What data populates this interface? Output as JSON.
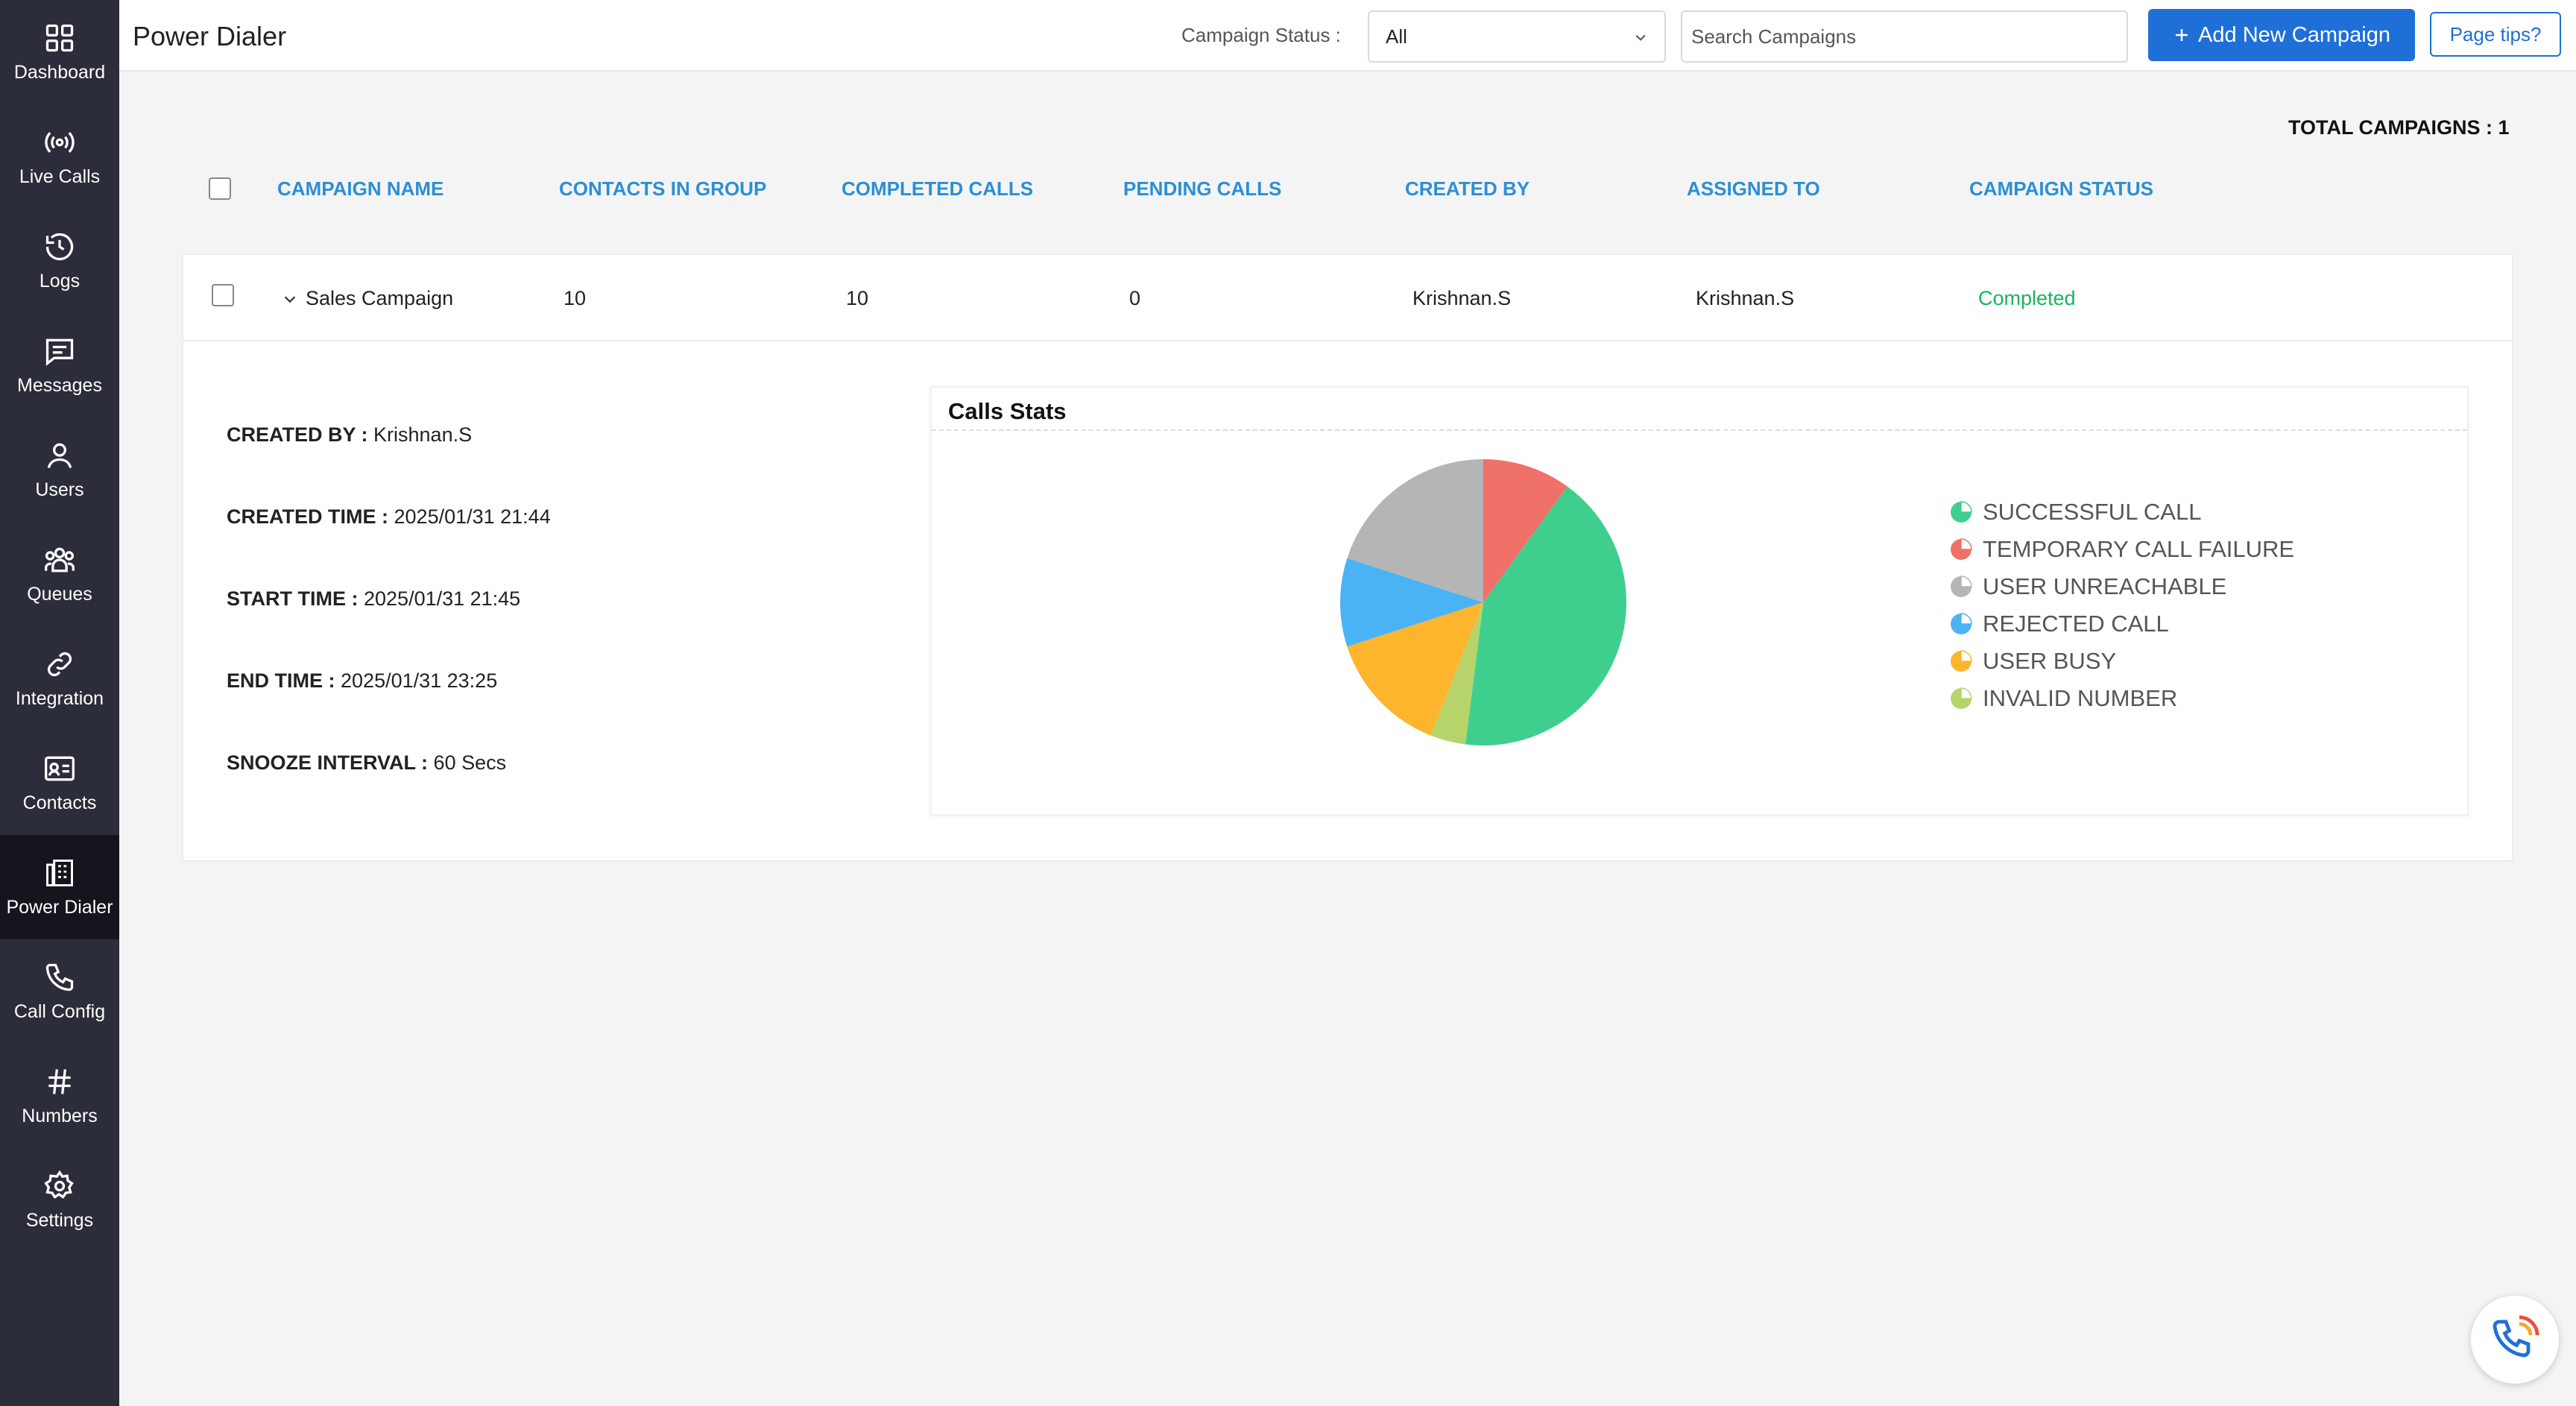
{
  "sidebar": {
    "items": [
      {
        "label": "Dashboard",
        "icon": "dashboard-icon"
      },
      {
        "label": "Live Calls",
        "icon": "broadcast-icon"
      },
      {
        "label": "Logs",
        "icon": "history-icon"
      },
      {
        "label": "Messages",
        "icon": "message-icon"
      },
      {
        "label": "Users",
        "icon": "user-icon"
      },
      {
        "label": "Queues",
        "icon": "group-icon"
      },
      {
        "label": "Integration",
        "icon": "link-icon"
      },
      {
        "label": "Contacts",
        "icon": "contact-card-icon"
      },
      {
        "label": "Power Dialer",
        "icon": "building-icon",
        "active": true
      },
      {
        "label": "Call Config",
        "icon": "phone-icon"
      },
      {
        "label": "Numbers",
        "icon": "hash-icon"
      },
      {
        "label": "Settings",
        "icon": "gear-icon"
      }
    ]
  },
  "header": {
    "title": "Power Dialer",
    "status_label": "Campaign Status :",
    "status_value": "All",
    "search_placeholder": "Search Campaigns",
    "add_button": "Add New Campaign",
    "tips_button": "Page tips?"
  },
  "total_campaigns": "TOTAL CAMPAIGNS : 1",
  "table": {
    "columns": [
      "CAMPAIGN NAME",
      "CONTACTS IN GROUP",
      "COMPLETED CALLS",
      "PENDING CALLS",
      "CREATED BY",
      "ASSIGNED TO",
      "CAMPAIGN STATUS"
    ],
    "rows": [
      {
        "name": "Sales Campaign",
        "contacts": "10",
        "completed": "10",
        "pending": "0",
        "created_by": "Krishnan.S",
        "assigned_to": "Krishnan.S",
        "status": "Completed"
      }
    ]
  },
  "details": {
    "created_by_label": "CREATED BY :",
    "created_by": "Krishnan.S",
    "created_time_label": "CREATED TIME :",
    "created_time": "2025/01/31 21:44",
    "start_time_label": "START TIME :",
    "start_time": "2025/01/31 21:45",
    "end_time_label": "END TIME :",
    "end_time": "2025/01/31 23:25",
    "snooze_label": "SNOOZE INTERVAL :",
    "snooze": "60 Secs"
  },
  "stats": {
    "title": "Calls Stats"
  },
  "chart_data": {
    "type": "pie",
    "title": "Calls Stats",
    "labels": [
      "SUCCESSFUL CALL",
      "TEMPORARY CALL FAILURE",
      "USER UNREACHABLE",
      "REJECTED CALL",
      "USER BUSY",
      "INVALID NUMBER"
    ],
    "values": [
      42,
      10,
      20,
      10,
      14,
      4
    ],
    "colors": [
      "#3ecf8e",
      "#f0706a",
      "#b5b5b5",
      "#4ab3f4",
      "#fdb52d",
      "#b7d46b"
    ]
  }
}
